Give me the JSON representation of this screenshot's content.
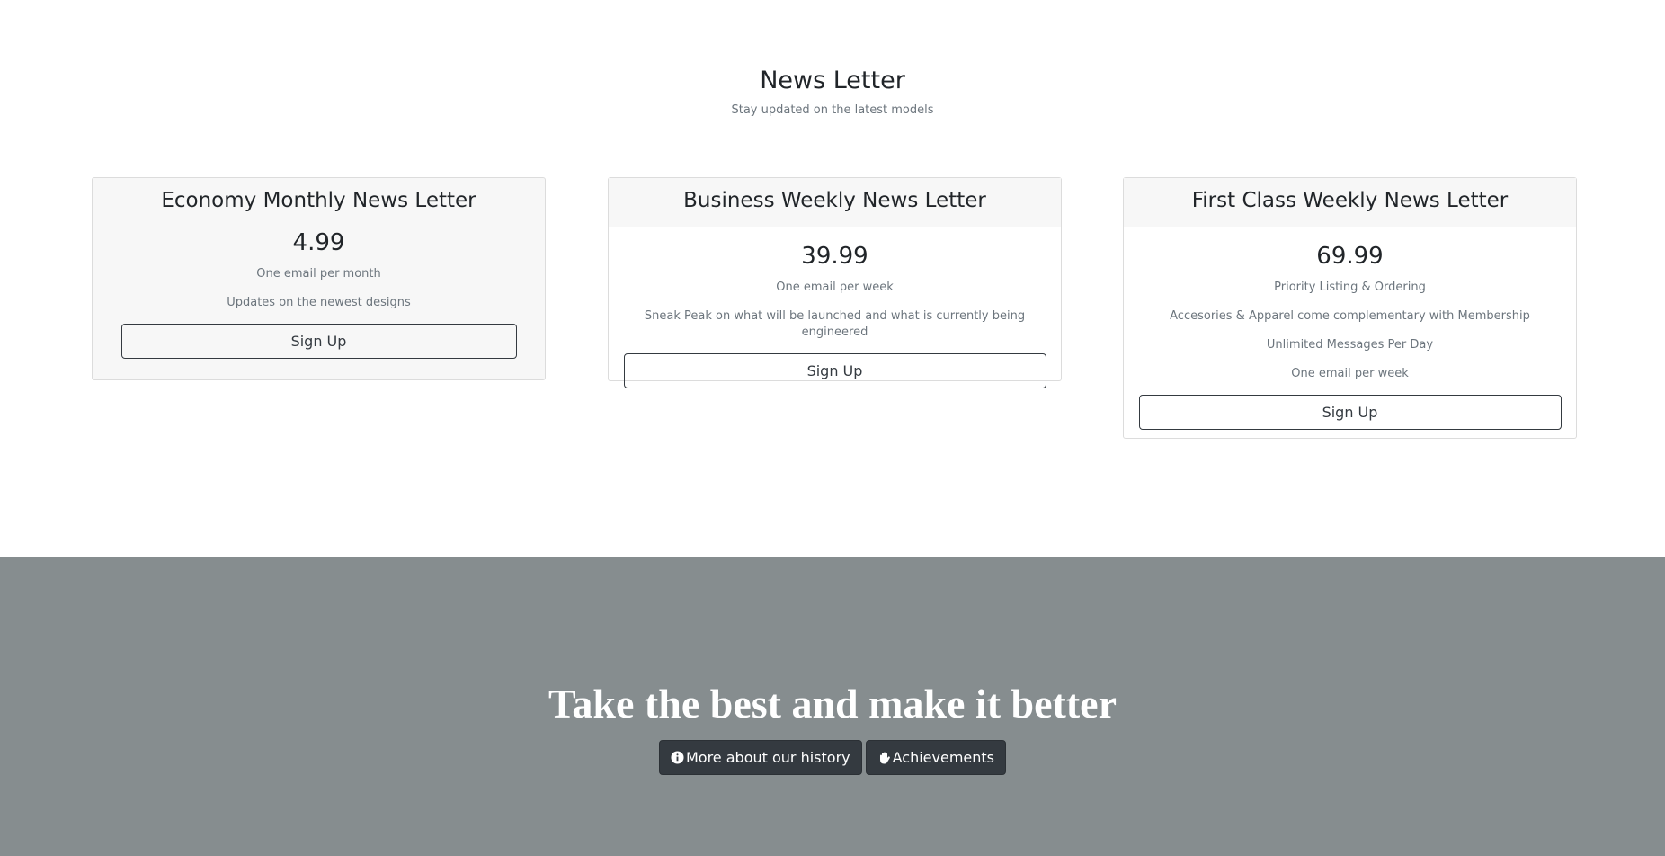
{
  "newsletter": {
    "title": "News Letter",
    "subtitle": "Stay updated on the latest models",
    "plans": [
      {
        "name": "Economy Monthly News Letter",
        "price": "4.99",
        "features": [
          "One email per month",
          "Updates on the newest designs"
        ],
        "button_label": "Sign Up"
      },
      {
        "name": "Business Weekly News Letter",
        "price": "39.99",
        "features": [
          "One email per week",
          "Sneak Peak on what will be launched and what is currently being engineered"
        ],
        "button_label": "Sign Up"
      },
      {
        "name": "First Class Weekly News Letter",
        "price": "69.99",
        "features": [
          "Priority Listing & Ordering",
          "Accesories & Apparel come complementary with Membership",
          "Unlimited Messages Per Day",
          "One email per week"
        ],
        "button_label": "Sign Up"
      }
    ]
  },
  "hero": {
    "title": "Take the best and make it better",
    "buttons": [
      {
        "label": "More about our history",
        "icon": "info-circle-icon"
      },
      {
        "label": "Achievements",
        "icon": "hand-icon"
      }
    ],
    "background_color": "#868d8f",
    "button_color": "#343a40"
  }
}
